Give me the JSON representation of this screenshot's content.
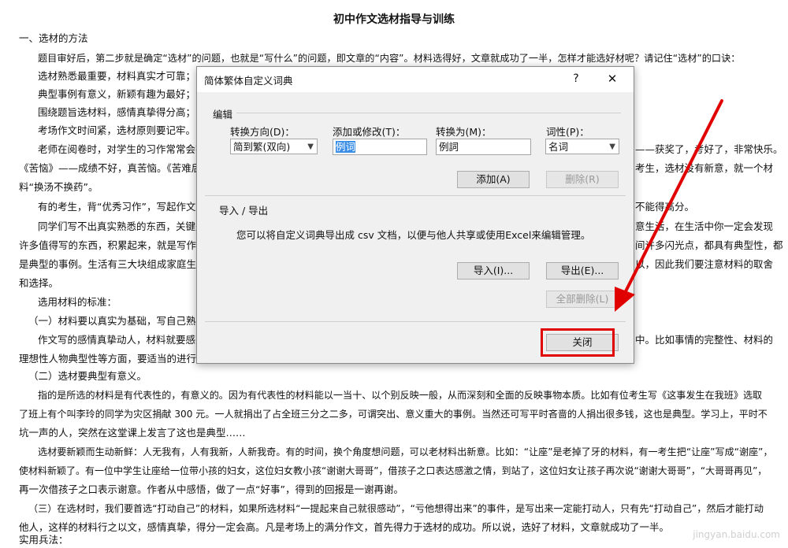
{
  "document": {
    "title": "初中作文选材指导与训练",
    "lines": [
      "一、选材的方法",
      "题目审好后，第二步就是确定“选材”的问题，也就是“写什么”的问题，即文章的“内容”。材料选得好，文章就成功了一半，怎样才能选好材呢？请记住“选材”的口诀：",
      "选材熟悉最重要，材料真实才可靠；",
      "典型事例有意义，新颖有趣为最好；",
      "围绕题旨选材料，感情真挚得分高；",
      "考场作文时间紧，选材原则要记牢。",
      "老师在阅卷时，对学生的习作常常会有",
      "——获奖了，考好了，非常快乐。",
      "《苦恼》——成绩不好，真苦恼。《苦难后",
      "考生，选材没有新意，就一个材",
      "料“换汤不换药”。",
      "有的考生，背“优秀习作”，写起作文来",
      "不能得高分。",
      "同学们写不出真实熟悉的东西，关键是",
      "意生活，在生活中你一定会发现",
      "许多值得写的东西，积累起来，就是写作的",
      "间许多闪光点，都具有典型性，都",
      "是典型的事例。生活有三大块组成家庭生活",
      "以，因此我们要注意材料的取舍",
      "和选择。",
      "选用材料的标准：",
      "（一）材料要以真实为基础，写自己熟悉",
      "作文写的感情真挚动人，材料就要感人",
      "中。比如事情的完整性、材料的",
      "理想性人物典型性等方面，要适当的进行加",
      "（二）选材要典型有意义。",
      "指的是所选的材料是有代表性的，有意义的。因为有代表性的材料能以一当十、以个别反映一般，从而深刻和全面的反映事物本质。比如有位考生写《这事发生在我班》选取",
      "了班上有个叫李玲的同学为灾区捐献 300 元。一人就捐出了占全班三分之二多，可谓突出、意义重大的事例。当然还可写平时吝啬的人捐出很多钱，这也是典型。学习上，平时不",
      "坑一声的人，突然在这堂课上发言了这也是典型……",
      "选材要新颖而生动新鲜：人无我有，人有我新，人新我奇。有的时间，换个角度想问题，可以老材料出新意。比如：“让座”是老掉了牙的材料，有一考生把“让座”写成“谢座”，",
      "使材料新颖了。有一位中学生让座给一位带小孩的妇女，这位妇女教小孩“谢谢大哥哥”，借孩子之口表达感激之情，到站了，这位妇女让孩子再次说“谢谢大哥哥”，“大哥哥再见”，",
      "再一次借孩子之口表示谢意。作者从中感悟，做了一点“好事”，得到的回报是一谢再谢。",
      "（三）在选材时，我们要首选“打动自己”的材料，如果所选材料“一提起来自己就很感动”，“亏他想得出来”的事件，是写出来一定能打动人，只有先“打动自己”，然后才能打动",
      "他人，这样的材料行之以文，感情真挚，得分一定会高。凡是考场上的满分作文，首先得力于选材的成功。所以说，选好了材料，文章就成功了一半。",
      "实用兵法："
    ]
  },
  "dialog": {
    "title": "简体繁体自定义词典",
    "help_glyph": "?",
    "close_glyph": "✕",
    "edit_group": "编辑",
    "direction_label": "转换方向(D)：",
    "direction_value": "简到繁(双向)",
    "add_modify_label": "添加或修改(T)：",
    "add_modify_value": "例词",
    "convert_to_label": "转换为(M)：",
    "convert_to_value": "例詞",
    "pos_label": "词性(P)：",
    "pos_value": "名词",
    "add_button": "添加(A)",
    "delete_button": "删除(R)",
    "io_group": "导入 / 导出",
    "io_description": "您可以将自定义词典导出成 csv 文档，以便与他人共享或使用Excel来编辑管理。",
    "import_button": "导入(I)...",
    "export_button": "导出(E)...",
    "delete_all_button": "全部删除(L)",
    "close_button": "关闭"
  },
  "colors": {
    "highlight": "#e00000",
    "arrow": "#e00000",
    "selection": "#3a8ee6"
  },
  "watermark": "jingyan.baidu.com"
}
